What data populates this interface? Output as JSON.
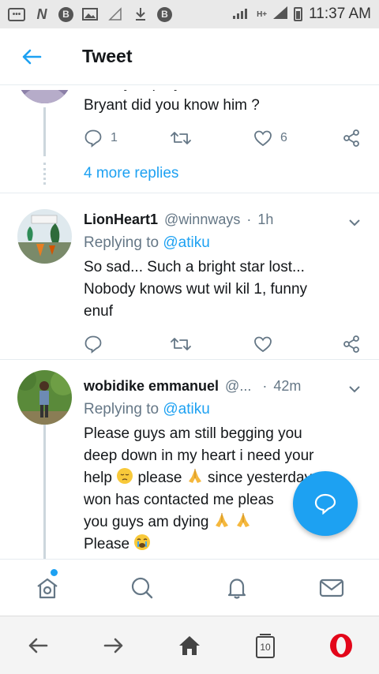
{
  "status_bar": {
    "time": "11:37 AM",
    "network": "H+",
    "icons": [
      "chat-icon",
      "n-icon",
      "b-icon",
      "image-icon",
      "signal-off-icon",
      "download-icon",
      "b-icon",
      "wifi-signal-icon",
      "cell-signal-icon",
      "battery-icon"
    ]
  },
  "header": {
    "title": "Tweet",
    "back_icon": "arrow-left-icon"
  },
  "tweets": [
    {
      "partial_text": "when you prayed for the soul of Kobe",
      "text": "Bryant did you know him ?",
      "reply_count": "1",
      "like_count": "6"
    },
    {
      "name": "LionHeart1",
      "handle": "@winnways",
      "dot": "·",
      "time": "1h",
      "replying_prefix": "Replying to",
      "replying_to": "@atiku",
      "lines": [
        "So sad... Such a bright star lost...",
        "Nobody knows wut wil kil 1, funny",
        "enuf"
      ]
    },
    {
      "name": "wobidike emmanuel",
      "handle": "@...",
      "dot": "·",
      "time": "42m",
      "replying_prefix": "Replying to",
      "replying_to": "@atiku",
      "lines": [
        "Please guys am still begging you",
        "deep down in my heart i need your",
        "please",
        "since yesterday no",
        "won has contacted me pleas",
        "you guys am dying",
        "Please"
      ],
      "help_word": "help"
    }
  ],
  "more_replies": "4 more replies",
  "tab_bar": [
    "home-icon",
    "search-icon",
    "notifications-icon",
    "messages-icon"
  ],
  "browser_bar": {
    "tab_count": "10"
  },
  "colors": {
    "accent": "#1da1f2",
    "text": "#14171a",
    "muted": "#657786",
    "opera": "#e3061a"
  }
}
